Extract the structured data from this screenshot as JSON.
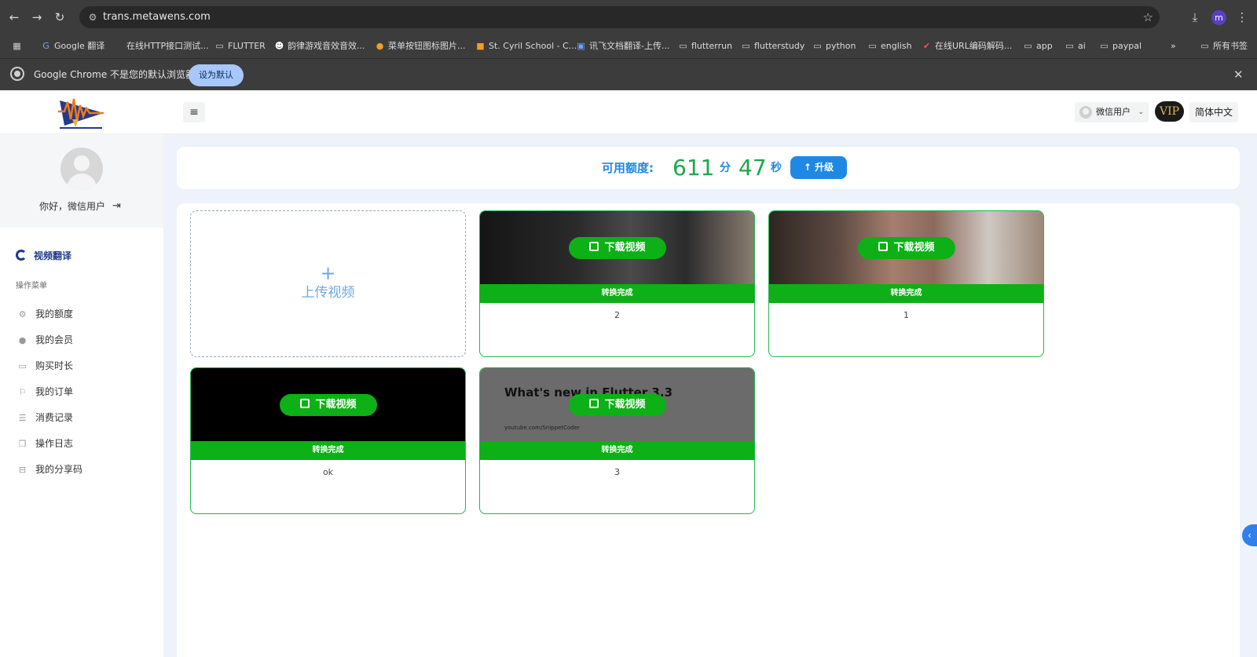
{
  "browser": {
    "url": "trans.metawens.com",
    "profile_initial": "m",
    "bookmarks": [
      {
        "label": "Google 翻译",
        "icon": "translate-icon"
      },
      {
        "label": "在线HTTP接口测试...",
        "icon": "web-icon"
      },
      {
        "label": "FLUTTER",
        "icon": "folder-icon"
      },
      {
        "label": "韵律游戏音效音效...",
        "icon": "web-icon"
      },
      {
        "label": "菜单按钮图标图片...",
        "icon": "web-icon"
      },
      {
        "label": "St. Cyril School - C...",
        "icon": "web-icon"
      },
      {
        "label": "讯飞文档翻译-上传...",
        "icon": "web-icon"
      },
      {
        "label": "flutterrun",
        "icon": "folder-icon"
      },
      {
        "label": "flutterstudy",
        "icon": "folder-icon"
      },
      {
        "label": "python",
        "icon": "folder-icon"
      },
      {
        "label": "english",
        "icon": "folder-icon"
      },
      {
        "label": "在线URL编码解码...",
        "icon": "web-icon"
      },
      {
        "label": "app",
        "icon": "folder-icon"
      },
      {
        "label": "ai",
        "icon": "folder-icon"
      },
      {
        "label": "paypal",
        "icon": "folder-icon"
      }
    ],
    "all_bookmarks": "所有书签",
    "infobar": {
      "message": "Google Chrome 不是您的默认浏览器",
      "button": "设为默认"
    }
  },
  "header": {
    "user_label": "微信用户",
    "vip_label": "VIP",
    "language": "简体中文"
  },
  "sidebar": {
    "greeting": "你好，微信用户",
    "active_item": "视频翻译",
    "section_label": "操作菜单",
    "items": [
      {
        "label": "我的额度",
        "icon": "gear-icon"
      },
      {
        "label": "我的会员",
        "icon": "info-icon"
      },
      {
        "label": "购买时长",
        "icon": "video-icon"
      },
      {
        "label": "我的订单",
        "icon": "flag-icon"
      },
      {
        "label": "消费记录",
        "icon": "sliders-icon"
      },
      {
        "label": "操作日志",
        "icon": "copy-icon"
      },
      {
        "label": "我的分享码",
        "icon": "share-icon"
      }
    ]
  },
  "quota": {
    "label": "可用额度:",
    "minutes": "611",
    "minutes_unit": "分",
    "seconds": "47",
    "seconds_unit": "秒",
    "upgrade_label": "升级"
  },
  "upload": {
    "label": "上传视频"
  },
  "videos": [
    {
      "name": "2",
      "status": "转换完成",
      "download_label": "下载视频"
    },
    {
      "name": "1",
      "status": "转换完成",
      "download_label": "下载视频"
    },
    {
      "name": "ok",
      "status": "转换完成",
      "download_label": "下载视频"
    },
    {
      "name": "3",
      "status": "转换完成",
      "download_label": "下载视频",
      "thumb_title": "What's new in Flutter 3.3",
      "thumb_url": "youtube.com/SnippetCoder"
    }
  ]
}
